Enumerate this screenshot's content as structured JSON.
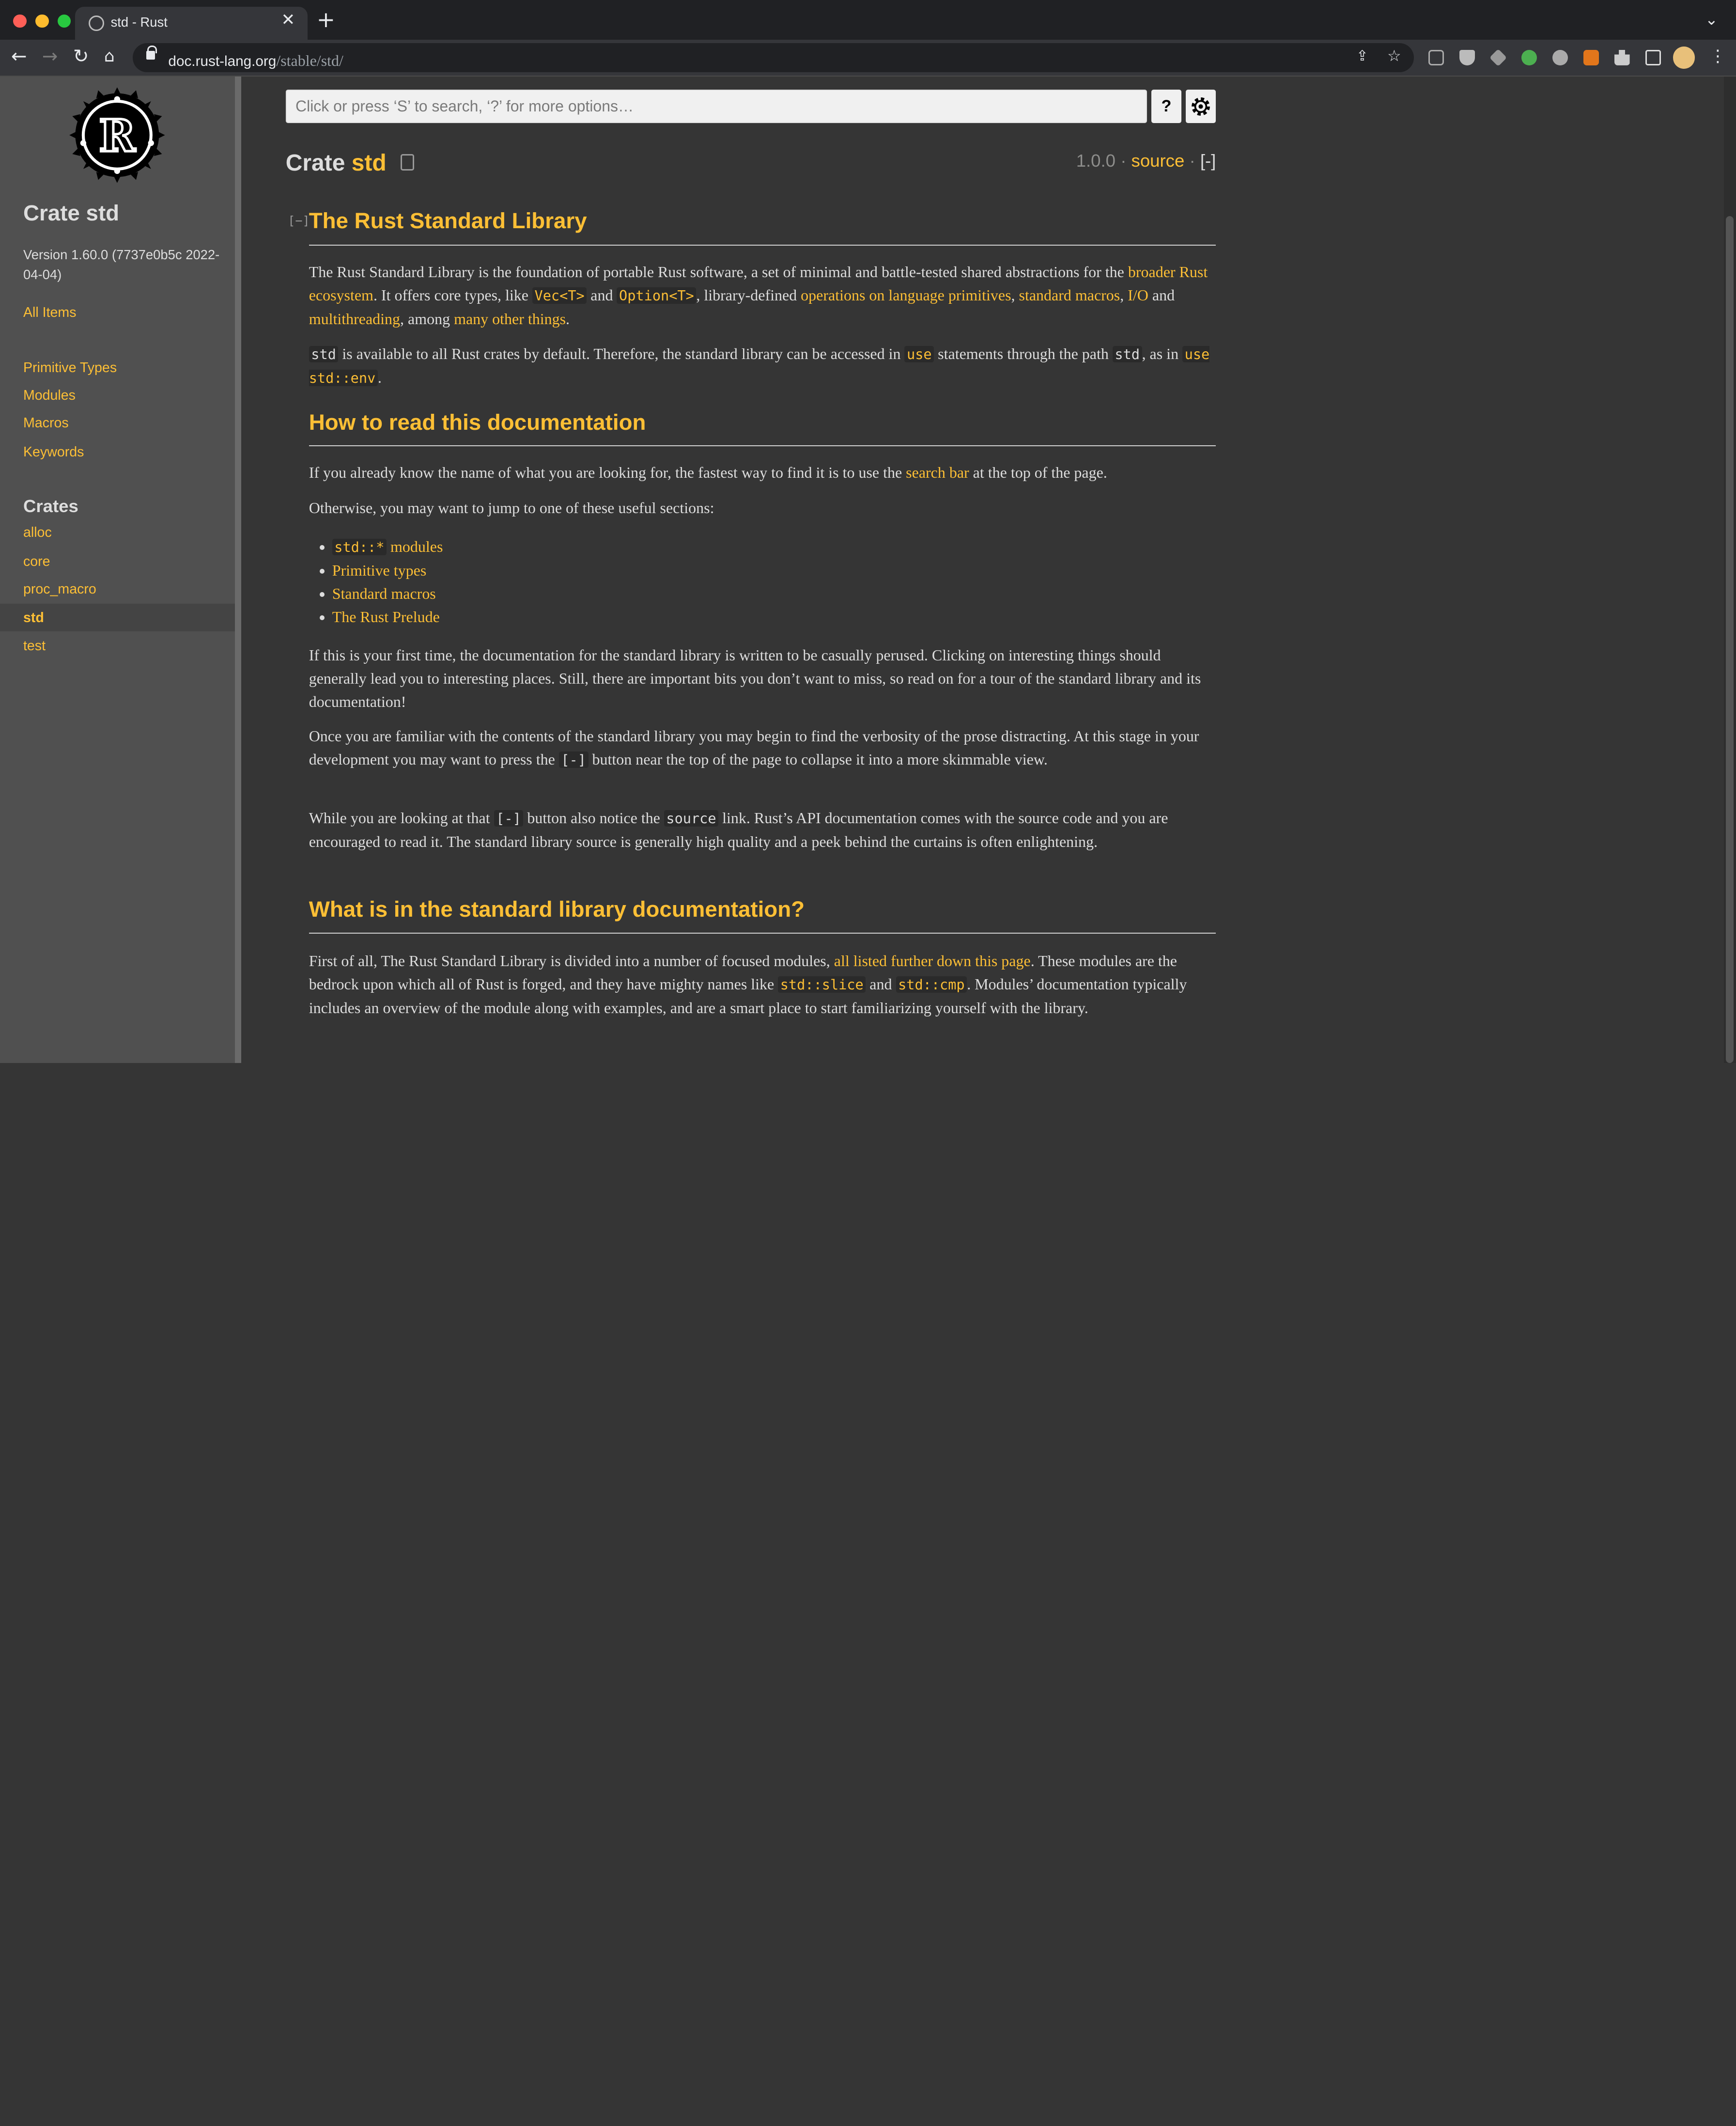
{
  "browser": {
    "tab_title": "std - Rust",
    "new_tab": "+",
    "close": "✕",
    "url_host": "doc.rust-lang.org",
    "url_path": "/stable/std/"
  },
  "sidebar": {
    "title": "Crate std",
    "version": "Version 1.60.0 (7737e0b5c 2022-04-04)",
    "all_items": "All Items",
    "sections": [
      "Primitive Types",
      "Modules",
      "Macros",
      "Keywords"
    ],
    "crates_heading": "Crates",
    "crates": [
      "alloc",
      "core",
      "proc_macro",
      "std",
      "test"
    ]
  },
  "search": {
    "placeholder": "Click or press ‘S’ to search, ‘?’ for more options…",
    "help_label": "?"
  },
  "header": {
    "crate_word": "Crate",
    "crate_name": "std",
    "version": "1.0.0",
    "sep": "·",
    "source": "source",
    "collapse": "[-]",
    "toggle": "[−]"
  },
  "content": {
    "h1": "The Rust Standard Library",
    "p1": {
      "t1": "The Rust Standard Library is the foundation of portable Rust software, a set of minimal and battle-tested shared abstractions for the ",
      "a1": "broader Rust ecosystem",
      "t2": ". It offers core types, like ",
      "c1": "Vec<T>",
      "t3": " and ",
      "c2": "Option<T>",
      "t4": ", library-defined ",
      "a2": "operations on language primitives",
      "t5": ", ",
      "a3": "standard macros",
      "t6": ", ",
      "a4": "I/O",
      "t7": " and ",
      "a5": "multithreading",
      "t8": ", among ",
      "a6": "many other things",
      "t9": "."
    },
    "p2": {
      "c1": "std",
      "t1": " is available to all Rust crates by default. Therefore, the standard library can be accessed in ",
      "c2": "use",
      "t2": " statements through the path ",
      "c3": "std",
      "t3": ", as in ",
      "c4": "use std::env",
      "t4": "."
    },
    "h2": "How to read this documentation",
    "p3": {
      "t1": "If you already know the name of what you are looking for, the fastest way to find it is to use the ",
      "a1": "search bar",
      "t2": " at the top of the page."
    },
    "p4": "Otherwise, you may want to jump to one of these useful sections:",
    "list": {
      "item1_code": "std::*",
      "item1_text": " modules",
      "item2": "Primitive types",
      "item3": "Standard macros",
      "item4": "The Rust Prelude"
    },
    "p5": "If this is your first time, the documentation for the standard library is written to be casually perused. Clicking on interesting things should generally lead you to interesting places. Still, there are important bits you don’t want to miss, so read on for a tour of the standard library and its documentation!",
    "p6": {
      "t1": "Once you are familiar with the contents of the standard library you may begin to find the verbosity of the prose distracting. At this stage in your development you may want to press the ",
      "c1": "[-]",
      "t2": " button near the top of the page to collapse it into a more skimmable view."
    },
    "p7": {
      "t1": "While you are looking at that ",
      "c1": "[-]",
      "t2": " button also notice the ",
      "c2": "source",
      "t3": " link. Rust’s API documentation comes with the source code and you are encouraged to read it. The standard library source is generally high quality and a peek behind the curtains is often enlightening."
    },
    "h3": "What is in the standard library documentation?",
    "p8": {
      "t1": "First of all, The Rust Standard Library is divided into a number of focused modules, ",
      "a1": "all listed further down this page",
      "t2": ". These modules are the bedrock upon which all of Rust is forged, and they have mighty names like ",
      "c1": "std::slice",
      "t3": " and ",
      "c2": "std::cmp",
      "t4": ". Modules’ documentation typically includes an overview of the module along with examples, and are a smart place to start familiarizing yourself with the library."
    }
  }
}
